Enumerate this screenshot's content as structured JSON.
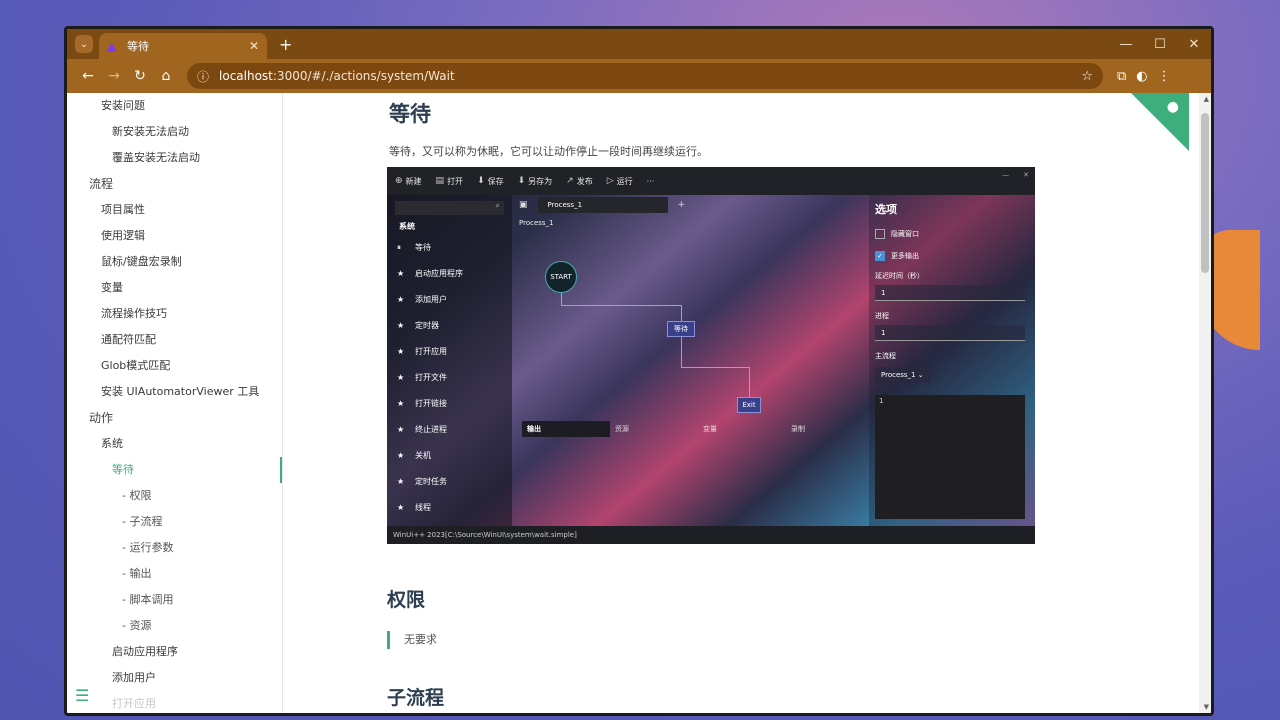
{
  "browser": {
    "tab_title": "等待",
    "tab_close": "✕",
    "new_tab": "+",
    "url_host": "localhost",
    "url_rest": ":3000/#/./actions/system/Wait"
  },
  "sidebar": {
    "items": [
      {
        "label": "安装问题",
        "level": 2
      },
      {
        "label": "新安装无法启动",
        "level": 3
      },
      {
        "label": "覆盖安装无法启动",
        "level": 3
      },
      {
        "label": "流程",
        "level": 1
      },
      {
        "label": "项目属性",
        "level": 2
      },
      {
        "label": "使用逻辑",
        "level": 2
      },
      {
        "label": "鼠标/键盘宏录制",
        "level": 2
      },
      {
        "label": "变量",
        "level": 2
      },
      {
        "label": "流程操作技巧",
        "level": 2
      },
      {
        "label": "通配符匹配",
        "level": 2
      },
      {
        "label": "Glob模式匹配",
        "level": 2
      },
      {
        "label": "安装 UIAutomatorViewer 工具",
        "level": 2
      },
      {
        "label": "动作",
        "level": 1
      },
      {
        "label": "系统",
        "level": 2
      },
      {
        "label": "等待",
        "level": 3,
        "active": true
      },
      {
        "label": "- 权限",
        "level": 4
      },
      {
        "label": "- 子流程",
        "level": 4
      },
      {
        "label": "- 运行参数",
        "level": 4
      },
      {
        "label": "- 输出",
        "level": 4
      },
      {
        "label": "- 脚本调用",
        "level": 4
      },
      {
        "label": "- 资源",
        "level": 4
      },
      {
        "label": "启动应用程序",
        "level": 3
      },
      {
        "label": "添加用户",
        "level": 3
      },
      {
        "label": "打开应用",
        "level": 3,
        "faded": true
      }
    ]
  },
  "main": {
    "title": "等待",
    "intro": "等待，又可以称为休眠，它可以让动作停止一段时间再继续运行。",
    "permissions_heading": "权限",
    "permissions_text": "无要求",
    "subprocess_heading": "子流程"
  },
  "screenshot": {
    "toolbar": [
      "新建",
      "打开",
      "保存",
      "另存为",
      "发布",
      "运行",
      "···"
    ],
    "search_icon": "⌕",
    "category": "系统",
    "actions": [
      "等待",
      "启动应用程序",
      "添加用户",
      "定时器",
      "打开应用",
      "打开文件",
      "打开链接",
      "终止进程",
      "关机",
      "定时任务",
      "线程"
    ],
    "tab": "Process_1",
    "tab_plus": "+",
    "process_label": "Process_1",
    "nodes": {
      "start": "START",
      "wait": "等待",
      "exit": "Exit"
    },
    "output_tabs": [
      "输出",
      "资源",
      "变量",
      "录制"
    ],
    "status": "WinUi++ 2023[C:\\Source\\WinUI\\system\\wait.simple]",
    "options": {
      "title": "选项",
      "hide_window": "隐藏窗口",
      "more_output": "更多输出",
      "delay_label": "延迟时间（秒）",
      "delay_value": "1",
      "progress_label": "进程",
      "progress_value": "1",
      "main_flow_label": "主流程",
      "main_flow_value": "Process_1 ⌄",
      "log_line": "1"
    }
  },
  "colors": {
    "accent": "#3eaf7c",
    "titlebar": "#7a4a12",
    "addressbar": "#a0651e"
  }
}
